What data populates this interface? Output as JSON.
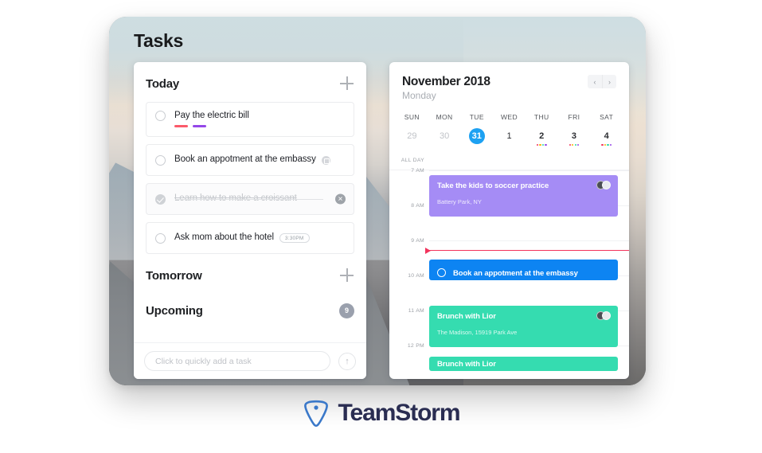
{
  "page": {
    "title": "Tasks"
  },
  "brand": {
    "name": "TeamStorm",
    "logo_icon": "teamstorm-pin-icon",
    "color": "#3a78c9"
  },
  "tasks": {
    "sections": [
      {
        "id": "today",
        "title": "Today",
        "add_icon": "plus-icon"
      },
      {
        "id": "tomorrow",
        "title": "Tomorrow",
        "add_icon": "plus-icon"
      },
      {
        "id": "upcoming",
        "title": "Upcoming",
        "count": "9"
      }
    ],
    "items": [
      {
        "label": "Pay the electric bill",
        "done": false,
        "tags": [
          "#fb5a6a",
          "#9447e8"
        ]
      },
      {
        "label": "Book an appotment at the embassy",
        "done": false,
        "badge_icon": "calendar-badge-icon"
      },
      {
        "label": "Learn how to make a croissant",
        "done": true,
        "remove_icon": "close-icon",
        "remove_label": "✕"
      },
      {
        "label": "Ask mom about the hotel",
        "done": false,
        "chip": "3:30PM"
      }
    ],
    "quick_add": {
      "placeholder": "Click to quickly add a task",
      "value": "",
      "submit_icon": "arrow-up-icon",
      "submit_glyph": "↑"
    }
  },
  "calendar": {
    "month": "November 2018",
    "weekday": "Monday",
    "nav": {
      "prev": "‹",
      "next": "›"
    },
    "day_names": [
      "SUN",
      "MON",
      "TUE",
      "WED",
      "THU",
      "FRI",
      "SAT"
    ],
    "dates": [
      {
        "num": "29",
        "state": "muted",
        "dots": []
      },
      {
        "num": "30",
        "state": "muted",
        "dots": []
      },
      {
        "num": "31",
        "state": "today",
        "dots": []
      },
      {
        "num": "1",
        "state": "normal",
        "dots": []
      },
      {
        "num": "2",
        "state": "bold",
        "dots": [
          "#f2335c",
          "#f7b500",
          "#2bd9a6",
          "#9447e8"
        ]
      },
      {
        "num": "3",
        "state": "bold",
        "dots": [
          "#f2335c",
          "#f7b500",
          "#2bd9a6",
          "#9447e8"
        ]
      },
      {
        "num": "4",
        "state": "bold",
        "dots": [
          "#f2335c",
          "#f7b500",
          "#2bd9a6",
          "#9447e8"
        ]
      }
    ],
    "all_day_label": "ALL DAY",
    "hours": [
      "7 AM",
      "8 AM",
      "9 AM",
      "10 AM",
      "11 AM",
      "12 PM"
    ],
    "events": [
      {
        "title": "Take the kids to soccer practice",
        "subtitle": "Battery Park, NY",
        "color": "#a58cf5",
        "avatars": true,
        "checkbox": false
      },
      {
        "title": "Book an appotment at the embassy",
        "subtitle": "",
        "color": "#0d84f2",
        "avatars": false,
        "checkbox": true
      },
      {
        "title": "Brunch with Lior",
        "subtitle": "The Madison, 15919 Park Ave",
        "color": "#35dcb0",
        "avatars": true,
        "checkbox": false
      },
      {
        "title": "Brunch with Lior",
        "subtitle": "",
        "color": "#35dcb0",
        "avatars": false,
        "checkbox": false
      }
    ],
    "now_marker": "current-time-indicator"
  }
}
